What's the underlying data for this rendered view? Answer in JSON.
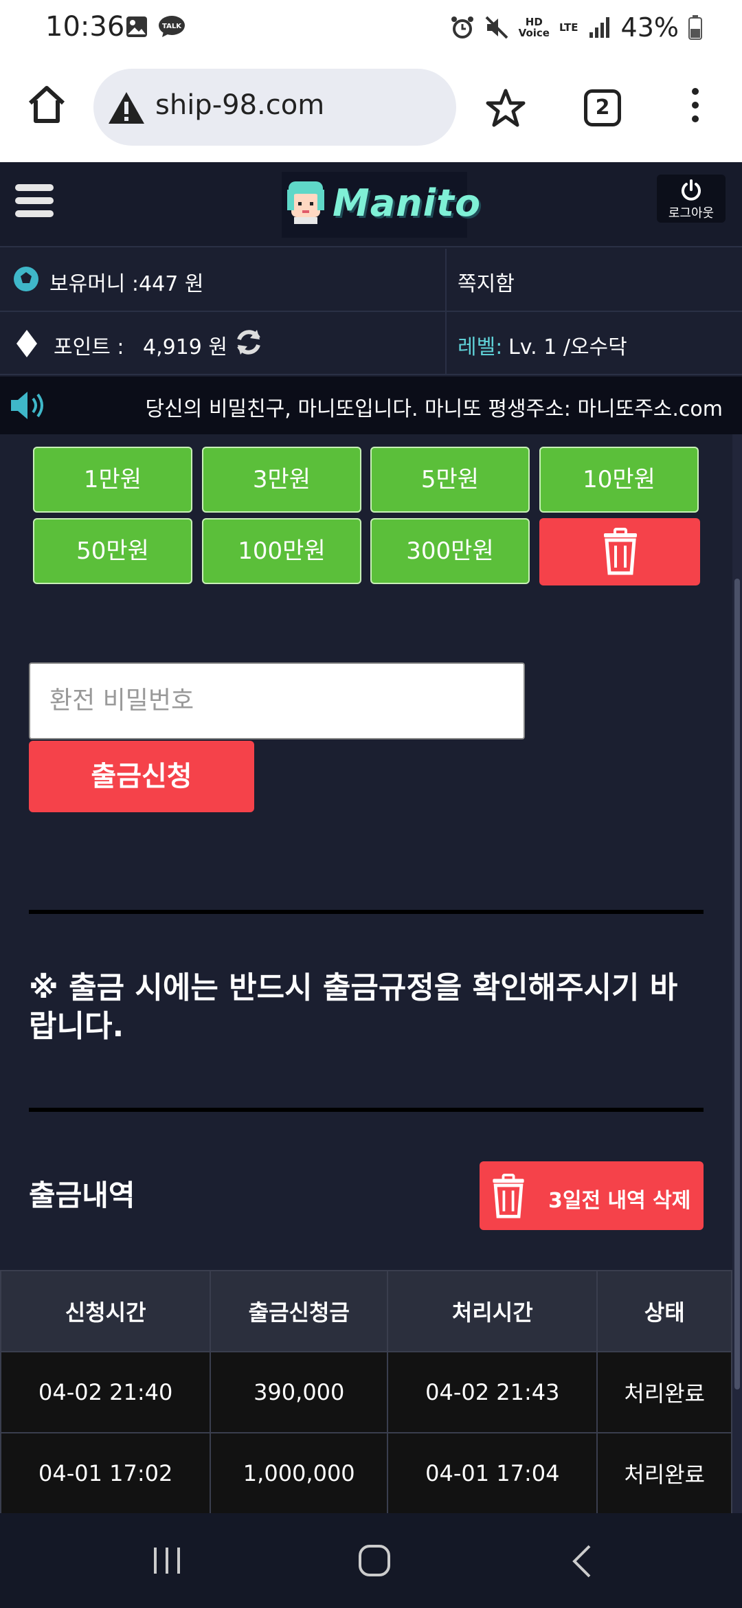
{
  "status_bar": {
    "time": "10:36",
    "battery": "43%",
    "hd_voice": "HD\nVoice",
    "lte": "LTE"
  },
  "browser": {
    "url": "ship-98.com",
    "tab_count": "2"
  },
  "header": {
    "logo_text": "Manito",
    "logout_label": "로그아웃"
  },
  "info": {
    "money_label": "보유머니 :447 원",
    "message_label": "쪽지함",
    "point_label": "포인트 :",
    "point_value": "4,919 원",
    "level_label": "레벨:",
    "level_value": "Lv. 1 /오수닥"
  },
  "marquee": {
    "text": "당신의 비밀친구, 마니또입니다. 마니또 평생주소: 마니또주소.com"
  },
  "amounts": [
    "1만원",
    "3만원",
    "5만원",
    "10만원",
    "50만원",
    "100만원",
    "300만원"
  ],
  "form": {
    "password_placeholder": "환전 비밀번호",
    "submit_label": "출금신청"
  },
  "notice": "※ 출금 시에는 반드시 출금규정을 확인해주시기 바랍니다.",
  "history": {
    "title": "출금내역",
    "delete_label": "3일전 내역 삭제",
    "columns": [
      "신청시간",
      "출금신청금",
      "처리시간",
      "상태"
    ],
    "rows": [
      [
        "04-02 21:40",
        "390,000",
        "04-02 21:43",
        "처리완료"
      ],
      [
        "04-01 17:02",
        "1,000,000",
        "04-01 17:04",
        "처리완료"
      ]
    ]
  },
  "colors": {
    "accent_green": "#5bbf3a",
    "accent_red": "#f5424a",
    "background": "#1b1f30",
    "level_label": "#5fd0d6"
  }
}
